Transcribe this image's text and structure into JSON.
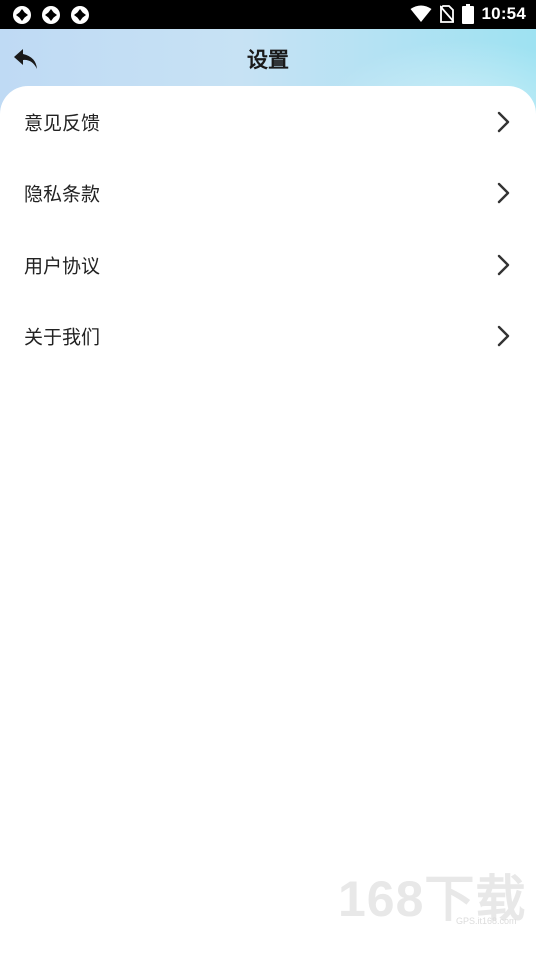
{
  "status_bar": {
    "time": "10:54",
    "left_icons": [
      "app-notification-icon",
      "app-notification-icon",
      "app-notification-icon"
    ],
    "right_icons": [
      "wifi-icon",
      "no-sim-icon",
      "battery-icon"
    ]
  },
  "header": {
    "title": "设置",
    "back_icon": "back-arrow-icon"
  },
  "menu": {
    "items": [
      {
        "label": "意见反馈",
        "icon": "chevron-right-icon"
      },
      {
        "label": "隐私条款",
        "icon": "chevron-right-icon"
      },
      {
        "label": "用户协议",
        "icon": "chevron-right-icon"
      },
      {
        "label": "关于我们",
        "icon": "chevron-right-icon"
      }
    ]
  },
  "watermark": {
    "text": "168下载",
    "sub": "GPS.it168.com"
  },
  "colors": {
    "header_gradient_start": "#bfdaf4",
    "header_gradient_end": "#9ee2f2",
    "text": "#222222",
    "status_bar": "#000000"
  }
}
